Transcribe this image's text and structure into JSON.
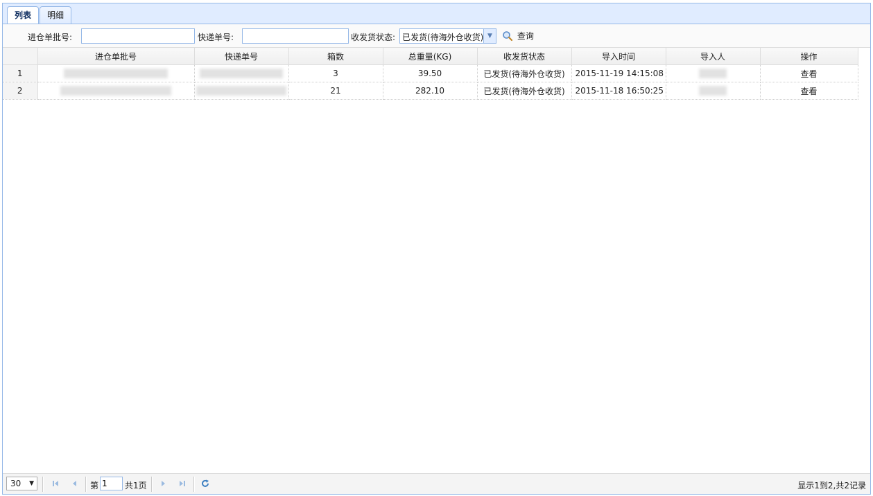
{
  "tabs": [
    {
      "label": "列表",
      "active": true
    },
    {
      "label": "明细",
      "active": false
    }
  ],
  "toolbar": {
    "batch_label": "进仓单批号:",
    "batch_value": "",
    "express_label": "快递单号:",
    "express_value": "",
    "status_label": "收发货状态:",
    "status_selected": "已发货(待海外仓收货)",
    "search_label": "查询"
  },
  "grid": {
    "columns": [
      "进仓单批号",
      "快递单号",
      "箱数",
      "总重量(KG)",
      "收发货状态",
      "导入时间",
      "导入人",
      "操作"
    ],
    "rows": [
      {
        "rownum": "1",
        "boxes": "3",
        "weight": "39.50",
        "status": "已发货(待海外仓收货)",
        "import_time": "2015-11-19 14:15:08",
        "action": "查看"
      },
      {
        "rownum": "2",
        "boxes": "21",
        "weight": "282.10",
        "status": "已发货(待海外仓收货)",
        "import_time": "2015-11-18 16:50:25",
        "action": "查看"
      }
    ]
  },
  "pager": {
    "page_size": "30",
    "page_prefix": "第",
    "page_number": "1",
    "page_total": "共1页",
    "info": "显示1到2,共2记录"
  },
  "colors": {
    "border": "#95b8e7",
    "tab_bg": "#e0ecff",
    "icon_blue": "#7aa6d6"
  }
}
